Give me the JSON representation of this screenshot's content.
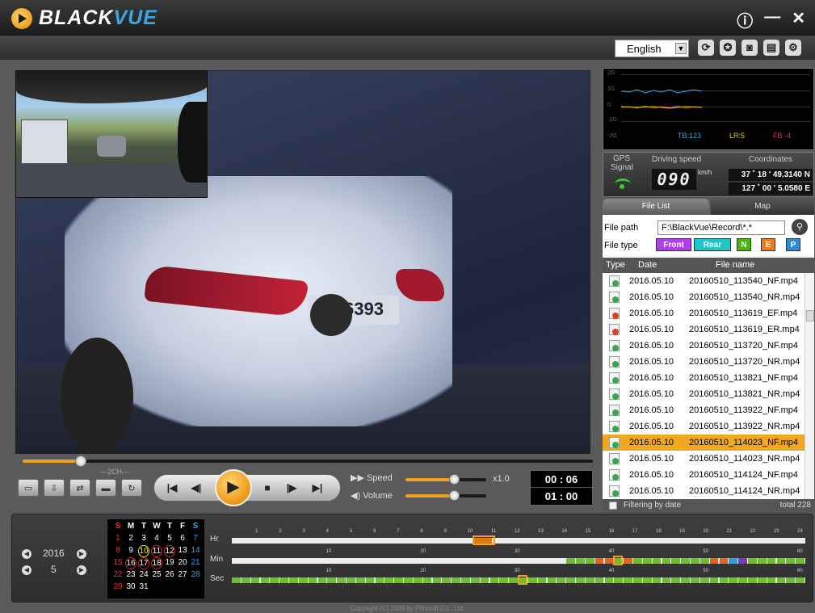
{
  "app": {
    "logo_text_a": "BLACK",
    "logo_text_b": "VUE",
    "info_btn": "ⓘ",
    "min_btn": "—",
    "close_btn": "✕",
    "copyright": "Copyright (C) 2009 by Pittasoft Co., Ltd."
  },
  "toolbar": {
    "language": "English",
    "icons": [
      "refresh-icon",
      "compass-icon",
      "camera-icon",
      "print-icon",
      "settings-icon"
    ],
    "icon_glyphs": [
      "⟳",
      "✪",
      "◙",
      "▤",
      "⚙"
    ]
  },
  "controls": {
    "seek_progress": 0.1,
    "channel_label": "2CH",
    "speed_label": "Speed",
    "speed_value": "x1.0",
    "speed_level": 0.6,
    "volume_label": "Volume",
    "volume_level": 0.6,
    "time_current": "00 : 06",
    "time_total": "01 : 00"
  },
  "gsensor": {
    "labels": [
      "2G",
      "1G",
      "0",
      "-1G",
      "-2G"
    ],
    "tb": "TB:123",
    "lr": "LR:5",
    "fb": "FB:-4",
    "colors": {
      "tb": "#3aa6e6",
      "lr": "#e6d800",
      "fb": "#e0287a"
    }
  },
  "gps": {
    "signal_label_1": "GPS",
    "signal_label_2": "Signal",
    "speed_title": "Driving speed",
    "speed_value": "090",
    "speed_unit": "km/h",
    "coord_title": "Coordinates",
    "lat": "37 ˚ 18 ' 49.3140 N",
    "lon": "127 ˚ 00 ' 5.0580 E"
  },
  "tabs": {
    "file_list": "File List",
    "map": "Map"
  },
  "files": {
    "path_label": "File path",
    "path_value": "F:\\BlackVue\\Record\\*.*",
    "type_label": "File type",
    "type_buttons": [
      {
        "label": "Front",
        "color": "#b23cf2"
      },
      {
        "label": "Rear",
        "color": "#1bc7c7"
      },
      {
        "label": "N",
        "color": "#49b800"
      },
      {
        "label": "E",
        "color": "#f07a18"
      },
      {
        "label": "P",
        "color": "#2a8ae0"
      }
    ],
    "col_type": "Type",
    "col_date": "Date",
    "col_name": "File name",
    "rows": [
      {
        "date": "2016.05.10",
        "name": "20160510_113540_NF.mp4",
        "kind": "N"
      },
      {
        "date": "2016.05.10",
        "name": "20160510_113540_NR.mp4",
        "kind": "N"
      },
      {
        "date": "2016.05.10",
        "name": "20160510_113619_EF.mp4",
        "kind": "E"
      },
      {
        "date": "2016.05.10",
        "name": "20160510_113619_ER.mp4",
        "kind": "E"
      },
      {
        "date": "2016.05.10",
        "name": "20160510_113720_NF.mp4",
        "kind": "N"
      },
      {
        "date": "2016.05.10",
        "name": "20160510_113720_NR.mp4",
        "kind": "N"
      },
      {
        "date": "2016.05.10",
        "name": "20160510_113821_NF.mp4",
        "kind": "N"
      },
      {
        "date": "2016.05.10",
        "name": "20160510_113821_NR.mp4",
        "kind": "N"
      },
      {
        "date": "2016.05.10",
        "name": "20160510_113922_NF.mp4",
        "kind": "N"
      },
      {
        "date": "2016.05.10",
        "name": "20160510_113922_NR.mp4",
        "kind": "N"
      },
      {
        "date": "2016.05.10",
        "name": "20160510_114023_NF.mp4",
        "kind": "N",
        "selected": true
      },
      {
        "date": "2016.05.10",
        "name": "20160510_114023_NR.mp4",
        "kind": "N"
      },
      {
        "date": "2016.05.10",
        "name": "20160510_114124_NF.mp4",
        "kind": "N"
      },
      {
        "date": "2016.05.10",
        "name": "20160510_114124_NR.mp4",
        "kind": "N"
      }
    ],
    "filter_label": "Filtering by date",
    "total": "total 228"
  },
  "calendar": {
    "year": "2016",
    "month": "5",
    "weekdays": [
      "S",
      "M",
      "T",
      "W",
      "T",
      "F",
      "S"
    ],
    "weeks": [
      [
        "1",
        "2",
        "3",
        "4",
        "5",
        "6",
        "7"
      ],
      [
        "8",
        "9",
        "10",
        "11",
        "12",
        "13",
        "14"
      ],
      [
        "15",
        "16",
        "17",
        "18",
        "19",
        "20",
        "21"
      ],
      [
        "22",
        "23",
        "24",
        "25",
        "26",
        "27",
        "28"
      ],
      [
        "29",
        "30",
        "31",
        "",
        "",
        "",
        ""
      ]
    ],
    "recorded_days": [
      "10",
      "11",
      "12",
      "16",
      "17",
      "18"
    ],
    "selected_day": "10"
  },
  "timeline": {
    "hr_label": "Hr",
    "min_label": "Min",
    "sec_label": "Sec",
    "hr_ticks": [
      "1",
      "2",
      "3",
      "4",
      "5",
      "6",
      "7",
      "8",
      "9",
      "10",
      "11",
      "12",
      "13",
      "14",
      "15",
      "16",
      "17",
      "18",
      "19",
      "20",
      "21",
      "22",
      "23",
      "24"
    ],
    "min_ticks": [
      "10",
      "20",
      "30",
      "40",
      "50",
      "60"
    ],
    "sec_ticks": [
      "10",
      "20",
      "30",
      "40",
      "50",
      "60"
    ],
    "hr_selected": 11,
    "min_selected": 40,
    "sec_selected": 30
  }
}
